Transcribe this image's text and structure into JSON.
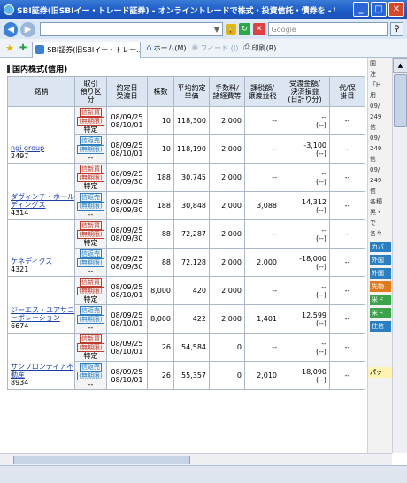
{
  "window": {
    "title": "SBI証券(旧SBIイー・トレード証券) - オンライントレードで株式・投資信託・債券を - Wind...",
    "btn_min": "_",
    "btn_max": "□",
    "btn_close": "✕"
  },
  "address": {
    "search_placeholder": "Google"
  },
  "command_bar": {
    "tab_label": "SBI証券(旧SBIイー・トレー...",
    "home_label": "ホーム(M)",
    "feed_label": "フィード (J)",
    "print_label": "印刷(R)"
  },
  "page": {
    "section_title": "国内株式(信用)"
  },
  "table": {
    "headers": [
      "銘柄",
      "取引\n預り区\n分",
      "約定日\n受渡日",
      "株数",
      "平均約定\n単価",
      "手数料/\n諸経費等",
      "課税額/\n譲渡益税",
      "受渡金額/\n決済損益\n(日計り分)",
      "代/保\n掛目"
    ],
    "groups": [
      {
        "name": "ngi group",
        "code": "2497",
        "rows": [
          {
            "type": "信新買",
            "term": "(無期限)",
            "acct": "特定",
            "date1": "08/09/25",
            "date2": "08/10/01",
            "qty": "10",
            "price": "118,300",
            "fee": "2,000",
            "tax": "--",
            "amount": "--",
            "pl": "(--)",
            "ratio": "--"
          },
          {
            "type": "信返売",
            "term": "(無期限)",
            "acct": "--",
            "date1": "08/09/25",
            "date2": "08/10/01",
            "qty": "10",
            "price": "118,190",
            "fee": "2,000",
            "tax": "--",
            "amount": "-3,100",
            "pl": "(--)",
            "ratio": "--"
          }
        ]
      },
      {
        "name": "ダヴィンチ・ホールディングス",
        "code": "4314",
        "rows": [
          {
            "type": "信新買",
            "term": "(無期限)",
            "acct": "特定",
            "date1": "08/09/25",
            "date2": "08/09/30",
            "qty": "188",
            "price": "30,745",
            "fee": "2,000",
            "tax": "--",
            "amount": "--",
            "pl": "(--)",
            "ratio": "--"
          },
          {
            "type": "信返売",
            "term": "(無期限)",
            "acct": "--",
            "date1": "08/09/25",
            "date2": "08/09/30",
            "qty": "188",
            "price": "30,848",
            "fee": "2,000",
            "tax": "3,088",
            "amount": "14,312",
            "pl": "(--)",
            "ratio": "--"
          }
        ]
      },
      {
        "name": "ケネディクス",
        "code": "4321",
        "rows": [
          {
            "type": "信新買",
            "term": "(無期限)",
            "acct": "特定",
            "date1": "08/09/25",
            "date2": "08/09/30",
            "qty": "88",
            "price": "72,287",
            "fee": "2,000",
            "tax": "--",
            "amount": "--",
            "pl": "(--)",
            "ratio": "--"
          },
          {
            "type": "信返売",
            "term": "(無期限)",
            "acct": "--",
            "date1": "08/09/25",
            "date2": "08/09/30",
            "qty": "88",
            "price": "72,128",
            "fee": "2,000",
            "tax": "2,000",
            "amount": "-18,000",
            "pl": "(--)",
            "ratio": "--"
          }
        ]
      },
      {
        "name": "ジーエス・ユアサコーポレーション",
        "code": "6674",
        "rows": [
          {
            "type": "信新買",
            "term": "(無期限)",
            "acct": "特定",
            "date1": "08/09/25",
            "date2": "08/10/01",
            "qty": "8,000",
            "price": "420",
            "fee": "2,000",
            "tax": "--",
            "amount": "--",
            "pl": "(--)",
            "ratio": "--"
          },
          {
            "type": "信返売",
            "term": "(無期限)",
            "acct": "--",
            "date1": "08/09/25",
            "date2": "08/10/01",
            "qty": "8,000",
            "price": "422",
            "fee": "2,000",
            "tax": "1,401",
            "amount": "12,599",
            "pl": "(--)",
            "ratio": "--"
          }
        ]
      },
      {
        "name": "サンフロンティア不動産",
        "code": "8934",
        "rows": [
          {
            "type": "信新買",
            "term": "(無期限)",
            "acct": "特定",
            "date1": "08/09/25",
            "date2": "08/10/01",
            "qty": "26",
            "price": "54,584",
            "fee": "0",
            "tax": "--",
            "amount": "--",
            "pl": "(--)",
            "ratio": "--"
          },
          {
            "type": "信返売",
            "term": "(無期限)",
            "acct": "--",
            "date1": "08/09/25",
            "date2": "08/10/01",
            "qty": "26",
            "price": "55,357",
            "fee": "0",
            "tax": "2,010",
            "amount": "18,090",
            "pl": "(--)",
            "ratio": "--"
          }
        ]
      }
    ]
  },
  "side": {
    "items": [
      "国",
      "注",
      "「H",
      "用",
      "09/",
      "249",
      "信",
      "09/",
      "249",
      "信",
      "09/",
      "249",
      "信",
      "各種",
      "黒・",
      "で",
      "各々"
    ],
    "chips": [
      {
        "label": "カバ",
        "color": "#2a7fc1"
      },
      {
        "label": "外国",
        "color": "#2a7fc1"
      },
      {
        "label": "外国",
        "color": "#2a7fc1"
      },
      {
        "label": "先物",
        "color": "#e07a1a"
      },
      {
        "label": "米ド",
        "color": "#3aa548"
      },
      {
        "label": "米ド",
        "color": "#3aa548"
      },
      {
        "label": "住信",
        "color": "#2a7fc1"
      }
    ],
    "bottom_label": "パッ"
  }
}
